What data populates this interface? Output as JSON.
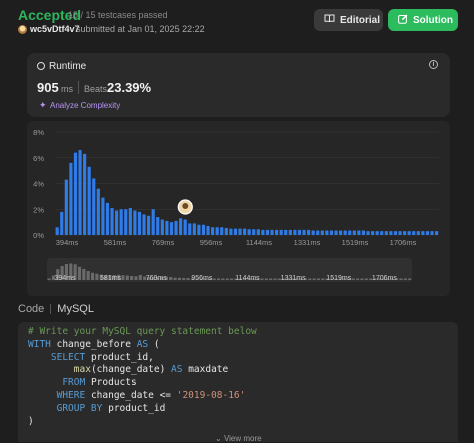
{
  "status": {
    "title": "Accepted",
    "testcases": "15 / 15 testcases passed",
    "username": "wc5vDtf4v7",
    "submitted": "submitted at Jan 01, 2025 22:22"
  },
  "actions": {
    "editorial": "Editorial",
    "solution": "Solution"
  },
  "runtime": {
    "label": "Runtime",
    "value": "905",
    "unit": "ms",
    "beats_label": "Beats",
    "beats_value": "23.39%",
    "analyze": "Analyze Complexity"
  },
  "colors": {
    "accepted": "#2db55d",
    "solution_button": "#2cbb5d",
    "bar": "#2f7be8",
    "analyze": "#b794f6"
  },
  "chart_data": {
    "type": "bar",
    "y_ticks": [
      "8%",
      "6%",
      "4%",
      "2%",
      "0%"
    ],
    "ylim": [
      0,
      8
    ],
    "x_ticks": [
      "394ms",
      "581ms",
      "769ms",
      "956ms",
      "1144ms",
      "1331ms",
      "1519ms",
      "1706ms"
    ],
    "xlim": [
      394,
      1900
    ],
    "marker_ms": 905,
    "values": [
      0.6,
      1.8,
      4.3,
      5.6,
      6.4,
      6.6,
      6.3,
      5.3,
      4.4,
      3.6,
      2.9,
      2.5,
      2.1,
      1.9,
      2.0,
      2.0,
      2.1,
      1.9,
      1.8,
      1.6,
      1.5,
      2.0,
      1.4,
      1.2,
      1.1,
      1.0,
      1.1,
      1.3,
      1.2,
      0.9,
      0.9,
      0.8,
      0.8,
      0.7,
      0.6,
      0.6,
      0.6,
      0.55,
      0.5,
      0.5,
      0.5,
      0.5,
      0.45,
      0.45,
      0.45,
      0.4,
      0.4,
      0.4,
      0.4,
      0.4,
      0.4,
      0.4,
      0.4,
      0.4,
      0.4,
      0.4,
      0.35,
      0.35,
      0.35,
      0.35,
      0.35,
      0.35,
      0.35,
      0.35,
      0.35,
      0.35,
      0.35,
      0.35,
      0.3,
      0.3,
      0.3,
      0.3,
      0.3,
      0.3,
      0.3,
      0.3,
      0.3,
      0.3,
      0.3,
      0.3,
      0.3,
      0.3,
      0.3,
      0.3
    ]
  },
  "code": {
    "label": "Code",
    "language": "MySQL",
    "lines": [
      [
        {
          "t": "# Write your MySQL query statement below",
          "c": "cm"
        }
      ],
      [
        {
          "t": "WITH ",
          "c": "kw"
        },
        {
          "t": "change_before ",
          "c": "plain"
        },
        {
          "t": "AS",
          "c": "kw"
        },
        {
          "t": " (",
          "c": "plain"
        }
      ],
      [
        {
          "t": "    ",
          "c": "plain"
        },
        {
          "t": "SELECT ",
          "c": "kw"
        },
        {
          "t": "product_id,",
          "c": "plain"
        }
      ],
      [
        {
          "t": "        ",
          "c": "plain"
        },
        {
          "t": "max",
          "c": "fn"
        },
        {
          "t": "(change_date) ",
          "c": "plain"
        },
        {
          "t": "AS ",
          "c": "kw"
        },
        {
          "t": "maxdate",
          "c": "plain"
        }
      ],
      [
        {
          "t": "      ",
          "c": "plain"
        },
        {
          "t": "FROM ",
          "c": "kw"
        },
        {
          "t": "Products",
          "c": "plain"
        }
      ],
      [
        {
          "t": "     ",
          "c": "plain"
        },
        {
          "t": "WHERE ",
          "c": "kw"
        },
        {
          "t": "change_date <= ",
          "c": "plain"
        },
        {
          "t": "'2019-08-16'",
          "c": "str"
        }
      ],
      [
        {
          "t": "     ",
          "c": "plain"
        },
        {
          "t": "GROUP BY ",
          "c": "kw"
        },
        {
          "t": "product_id",
          "c": "plain"
        }
      ],
      [
        {
          "t": ")",
          "c": "plain"
        }
      ]
    ],
    "view_more": "View more"
  }
}
